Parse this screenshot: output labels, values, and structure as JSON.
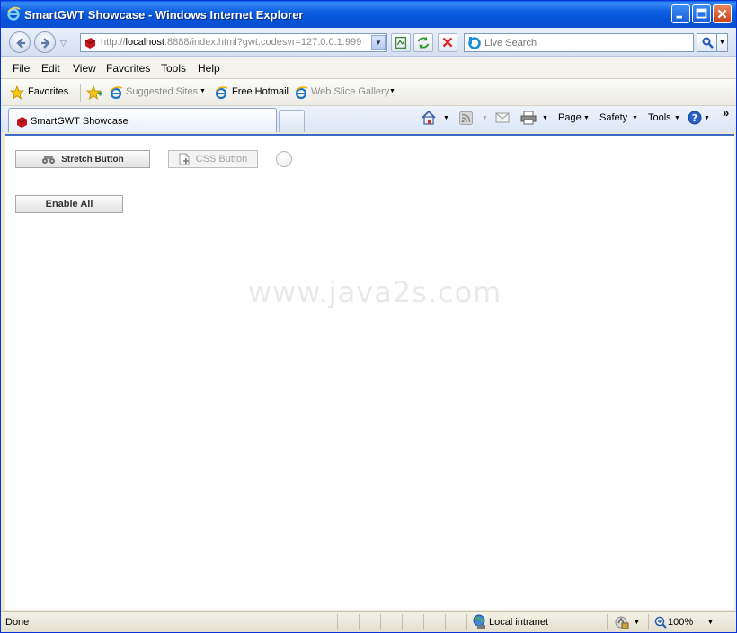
{
  "window": {
    "title": "SmartGWT Showcase - Windows Internet Explorer",
    "minimize": "0",
    "maximize": "1",
    "close": "r"
  },
  "address": {
    "url_prefix": "http://",
    "url_host": "localhost",
    "url_rest": ":8888/index.html?gwt.codesvr=127.0.0.1:999"
  },
  "search": {
    "placeholder": "Live Search"
  },
  "menu": {
    "items": [
      "File",
      "Edit",
      "View",
      "Favorites",
      "Tools",
      "Help"
    ]
  },
  "favorites_bar": {
    "favorites_label": "Favorites",
    "suggested_sites": "Suggested Sites",
    "free_hotmail": "Free Hotmail",
    "web_slice_gallery": "Web Slice Gallery"
  },
  "tabs": [
    {
      "label": "SmartGWT Showcase"
    }
  ],
  "command_bar": {
    "page": "Page",
    "safety": "Safety",
    "tools": "Tools",
    "more": "»"
  },
  "content": {
    "stretch_button": "Stretch Button",
    "css_button": "CSS Button",
    "enable_all_button": "Enable All",
    "watermark": "www.java2s.com"
  },
  "status": {
    "text": "Done",
    "zone": "Local intranet",
    "zoom": "100%"
  },
  "colors": {
    "titlebar": "#0a5fe6",
    "content_border": "#3d6bc5",
    "disabled_text": "#a3a3a3"
  }
}
